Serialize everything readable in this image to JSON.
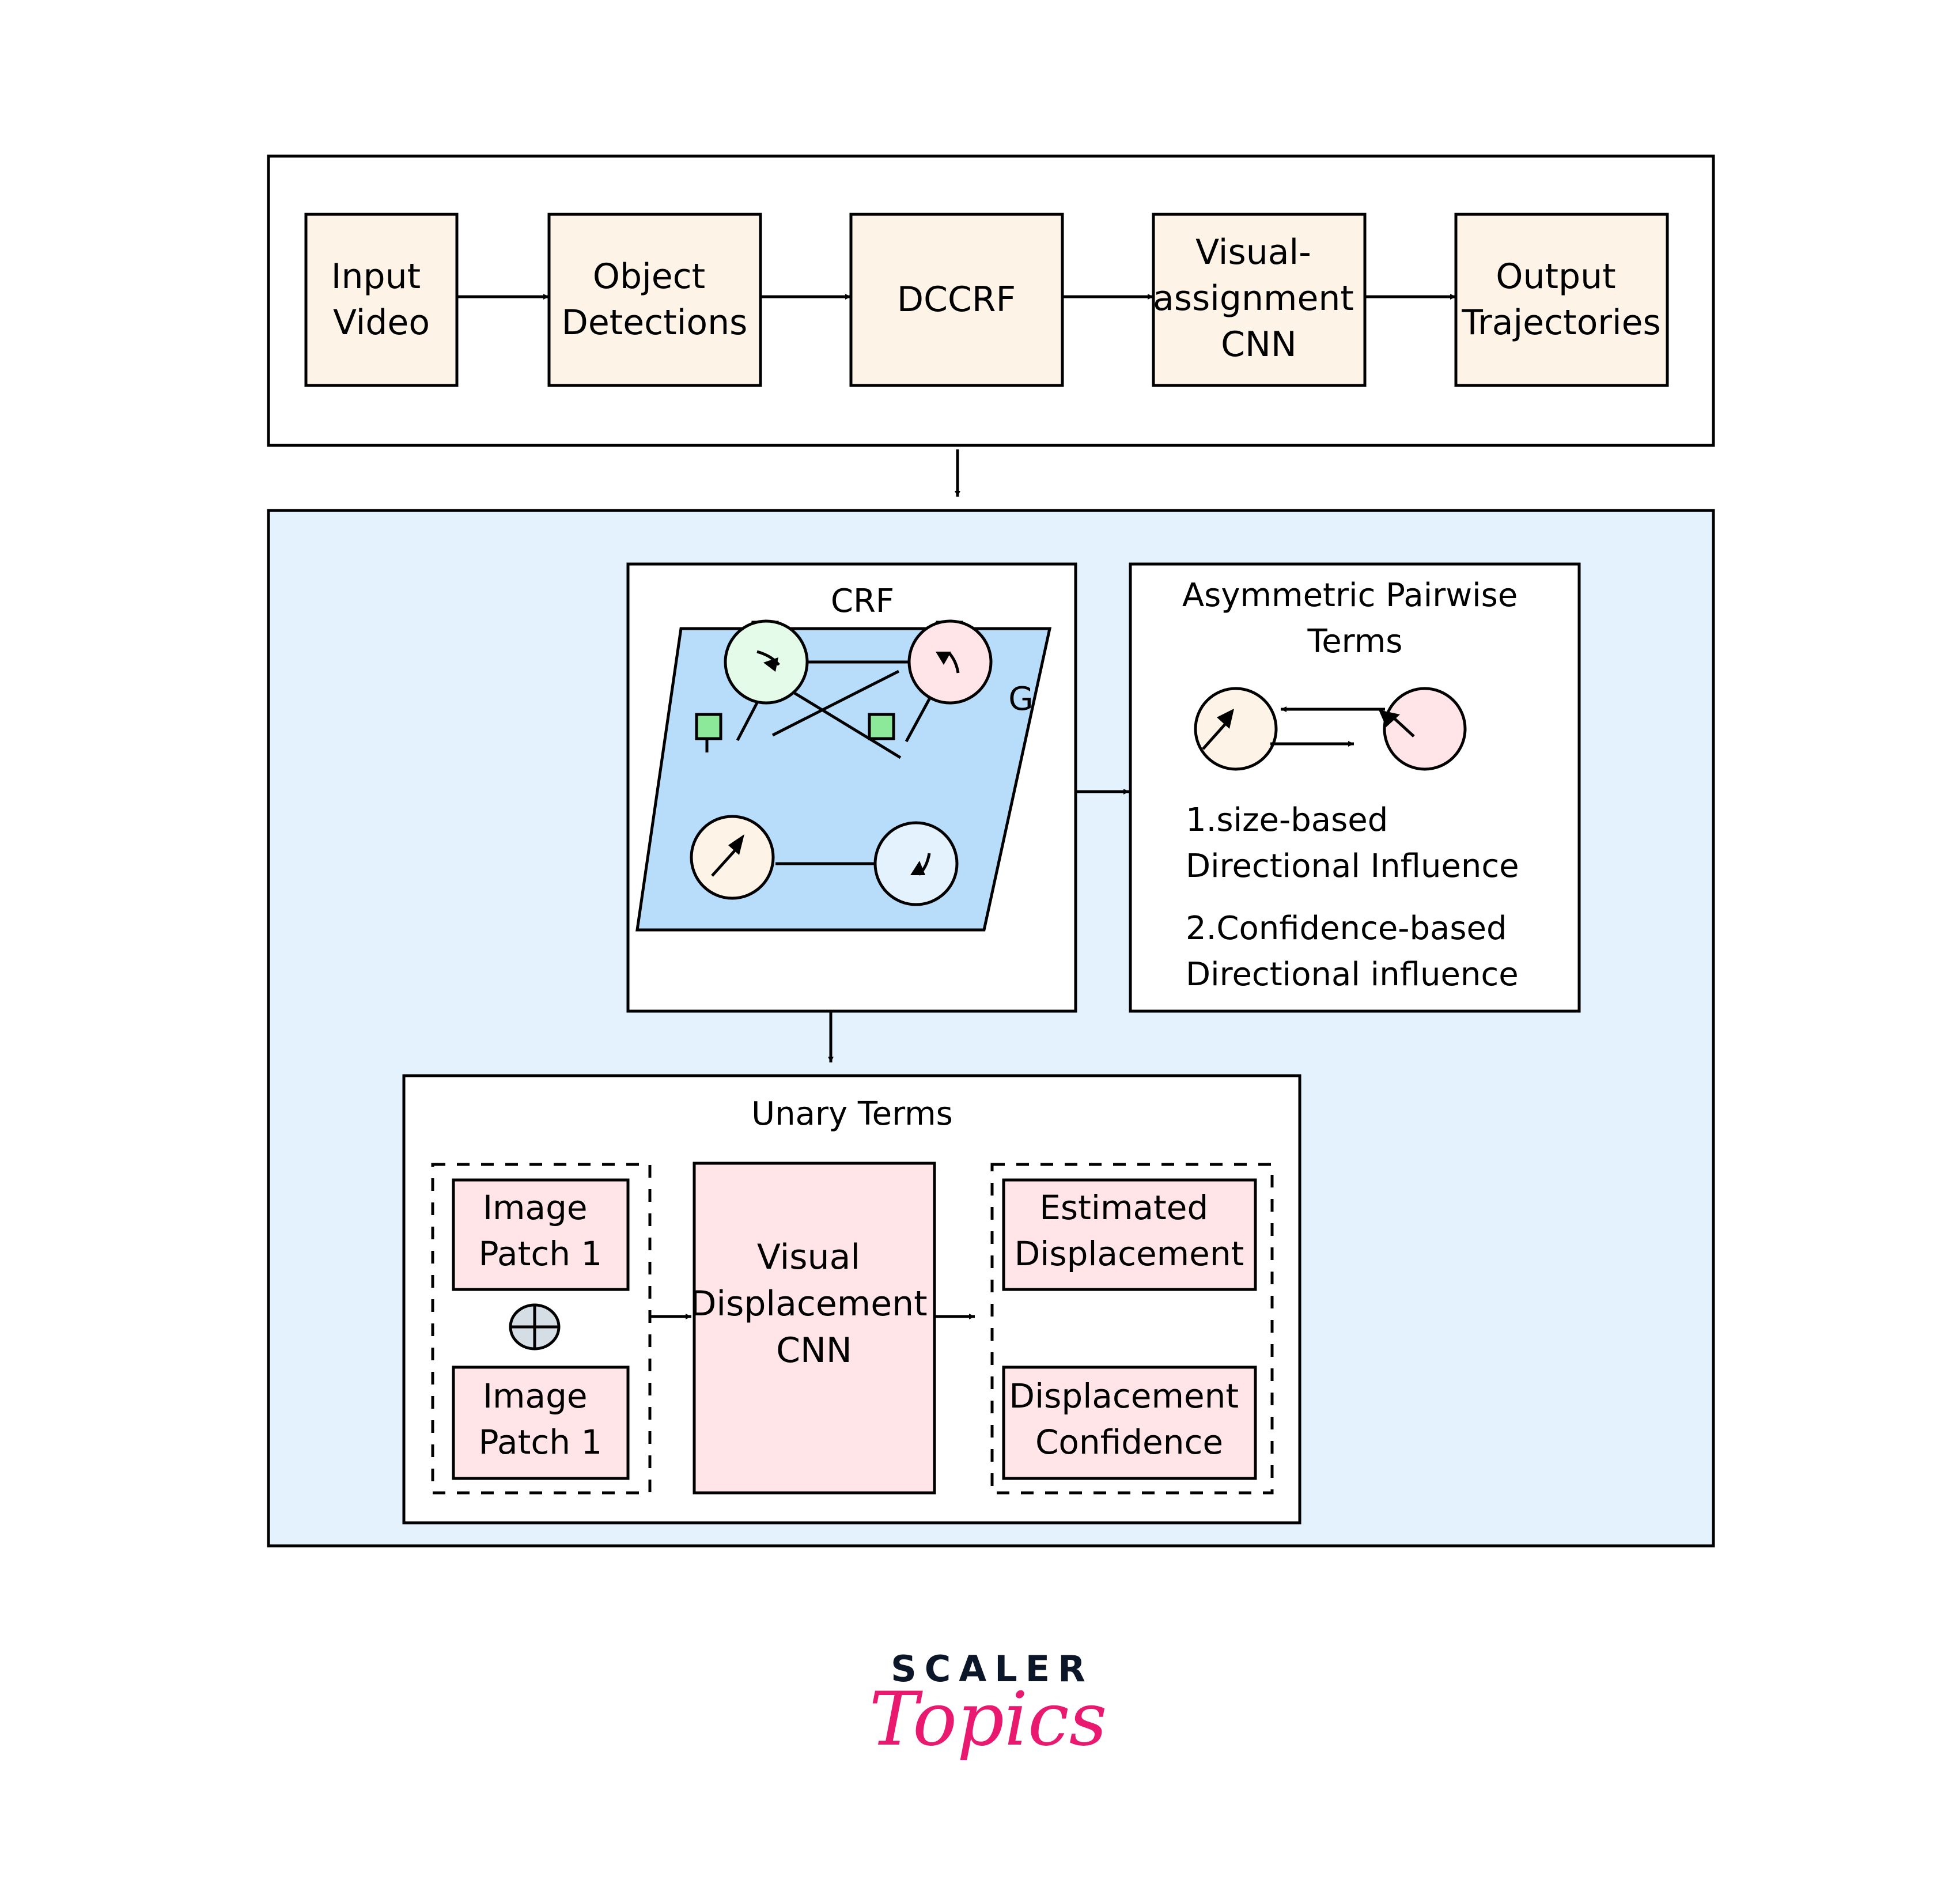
{
  "colors": {
    "stage_fill": "#fdf4e7",
    "panel_fill": "#e3f2fd",
    "plane_fill": "#b7ddfb",
    "factor_fill": "#8ce99a",
    "node_green": "#e5fbea",
    "node_pink": "#ffe5e8",
    "node_cream": "#fdf4e7",
    "node_blue": "#e3f2fd",
    "unary_fill": "#ffe5e8",
    "oplus_fill": "#d5dde5",
    "logo_dark": "#0b1629",
    "logo_pink": "#e8196f"
  },
  "pipeline": {
    "stages": [
      {
        "id": "input-video",
        "lines": [
          "Input",
          "Video"
        ]
      },
      {
        "id": "object-detections",
        "lines": [
          "Object",
          "Detections"
        ]
      },
      {
        "id": "dccrf",
        "lines": [
          "DCCRF"
        ]
      },
      {
        "id": "visual-assignment-cnn",
        "lines": [
          "Visual-",
          "assignment",
          "CNN"
        ]
      },
      {
        "id": "output-trajectories",
        "lines": [
          "Output",
          "Trajectories"
        ]
      }
    ]
  },
  "crf": {
    "title": "CRF",
    "graph_label": "G",
    "nodes": [
      {
        "id": "top-left",
        "color": "node_green",
        "glyph": "curved-arrow-right-down"
      },
      {
        "id": "top-right",
        "color": "node_pink",
        "glyph": "curved-arrow-up-left"
      },
      {
        "id": "bottom-left",
        "color": "node_cream",
        "glyph": "arrow-up-right"
      },
      {
        "id": "bottom-right",
        "color": "node_blue",
        "glyph": "curved-arrow-down-left"
      }
    ]
  },
  "pairwise": {
    "title_lines": [
      "Asymmetric Pairwise",
      "Terms"
    ],
    "items": [
      {
        "lines": [
          "1.size-based",
          "Directional Influence"
        ]
      },
      {
        "lines": [
          "2.Confidence-based",
          "Directional influence"
        ]
      }
    ]
  },
  "unary": {
    "title": "Unary Terms",
    "inputs": [
      {
        "lines": [
          "Image",
          "Patch 1"
        ]
      },
      {
        "lines": [
          "Image",
          "Patch 1"
        ]
      }
    ],
    "combine_symbol": "oplus",
    "cnn": {
      "lines": [
        "Visual",
        "Displacement",
        "CNN"
      ]
    },
    "outputs": [
      {
        "lines": [
          "Estimated",
          "Displacement"
        ]
      },
      {
        "lines": [
          "Displacement",
          "Confidence"
        ]
      }
    ]
  },
  "logo": {
    "top": "SCALER",
    "bottom": "Topics"
  }
}
